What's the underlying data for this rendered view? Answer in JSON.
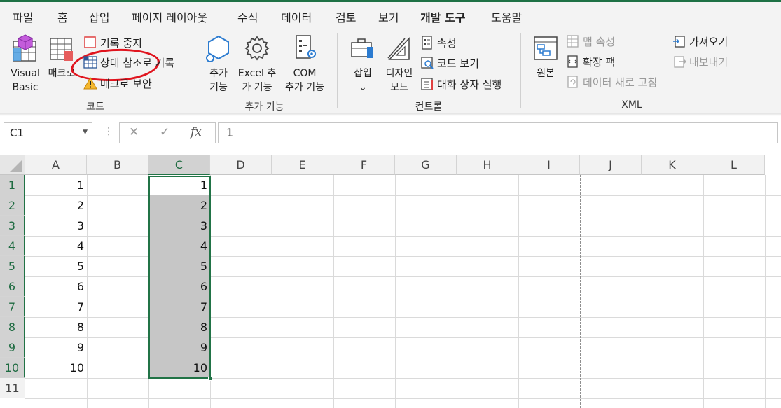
{
  "ribbon_tabs": [
    "파일",
    "홈",
    "삽입",
    "페이지 레이아웃",
    "수식",
    "데이터",
    "검토",
    "보기",
    "개발 도구",
    "도움말"
  ],
  "active_tab": "개발 도구",
  "groups": {
    "code": {
      "label": "코드",
      "visual_basic_line1": "Visual",
      "visual_basic_line2": "Basic",
      "macro": "매크로",
      "stop_recording": "기록 중지",
      "relative_reference": "상대 참조로 기록",
      "macro_security": "매크로 보안"
    },
    "addins": {
      "label": "추가 기능",
      "addins_line1": "추가",
      "addins_line2": "기능",
      "excel_addins_line1": "Excel 추",
      "excel_addins_line2": "가 기능",
      "com_addins_line1": "COM",
      "com_addins_line2": "추가 기능"
    },
    "controls": {
      "label": "컨트롤",
      "insert": "삽입",
      "insert_caret": "⌄",
      "design_mode_line1": "디자인",
      "design_mode_line2": "모드",
      "properties": "속성",
      "view_code": "코드 보기",
      "run_dialog": "대화 상자 실행"
    },
    "xml": {
      "label": "XML",
      "source": "원본",
      "map_properties": "맵 속성",
      "expansion_packs": "확장 팩",
      "refresh_data": "데이터 새로 고침",
      "import": "가져오기",
      "export": "내보내기"
    }
  },
  "formula_bar": {
    "name_box": "C1",
    "cancel_icon": "✕",
    "enter_icon": "✓",
    "fx_icon": "fx",
    "value": "1"
  },
  "columns": [
    "A",
    "B",
    "C",
    "D",
    "E",
    "F",
    "G",
    "H",
    "I",
    "J",
    "K",
    "L"
  ],
  "rows": [
    "1",
    "2",
    "3",
    "4",
    "5",
    "6",
    "7",
    "8",
    "9",
    "10",
    "11"
  ],
  "column_a": [
    "1",
    "2",
    "3",
    "4",
    "5",
    "6",
    "7",
    "8",
    "9",
    "10"
  ],
  "column_c": [
    "1",
    "2",
    "3",
    "4",
    "5",
    "6",
    "7",
    "8",
    "9",
    "10"
  ],
  "colors": {
    "accent_green": "#217346",
    "annotation_red": "#e0141e"
  }
}
